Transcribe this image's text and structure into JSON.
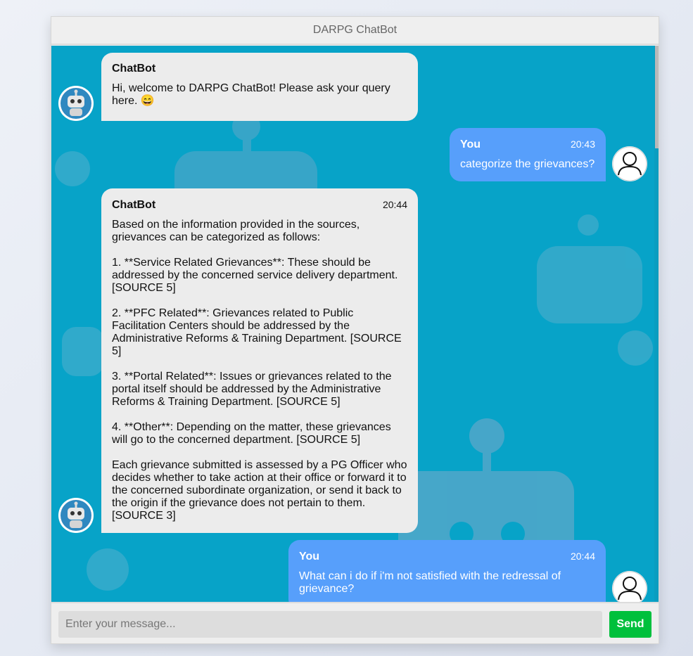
{
  "app": {
    "title": "DARPG ChatBot"
  },
  "messages": [
    {
      "sender": "ChatBot",
      "time": "",
      "text": "Hi, welcome to DARPG ChatBot! Please ask your query here. 😄"
    },
    {
      "sender": "You",
      "time": "20:43",
      "text": "categorize the grievances?"
    },
    {
      "sender": "ChatBot",
      "time": "20:44",
      "text": "Based on the information provided in the sources,\ngrievances can be categorized as follows:\n\n1. **Service Related Grievances**: These should be\naddressed by the concerned service delivery department.\n[SOURCE 5]\n\n2. **PFC Related**: Grievances related to Public\nFacilitation Centers should be addressed by the\nAdministrative Reforms & Training Department. [SOURCE\n5]\n\n3. **Portal Related**: Issues or grievances related to the\nportal itself should be addressed by the Administrative\nReforms & Training Department. [SOURCE 5]\n\n4. **Other**: Depending on the matter, these grievances\nwill go to the concerned department. [SOURCE 5]\n\nEach grievance submitted is assessed by a PG Officer who\ndecides whether to take action at their office or forward it to\nthe concerned subordinate organization, or send it back to\nthe origin if the grievance does not pertain to them.\n[SOURCE 3]"
    },
    {
      "sender": "You",
      "time": "20:44",
      "text": "What can i do if i'm not satisfied with the redressal of\ngrievance?"
    }
  ],
  "input": {
    "placeholder": "Enter your message..."
  },
  "send": {
    "label": "Send"
  },
  "colors": {
    "chat_bg": "#07a3c8",
    "bot_bubble": "#ececec",
    "user_bubble": "#579ffb",
    "send": "#00c03c"
  }
}
